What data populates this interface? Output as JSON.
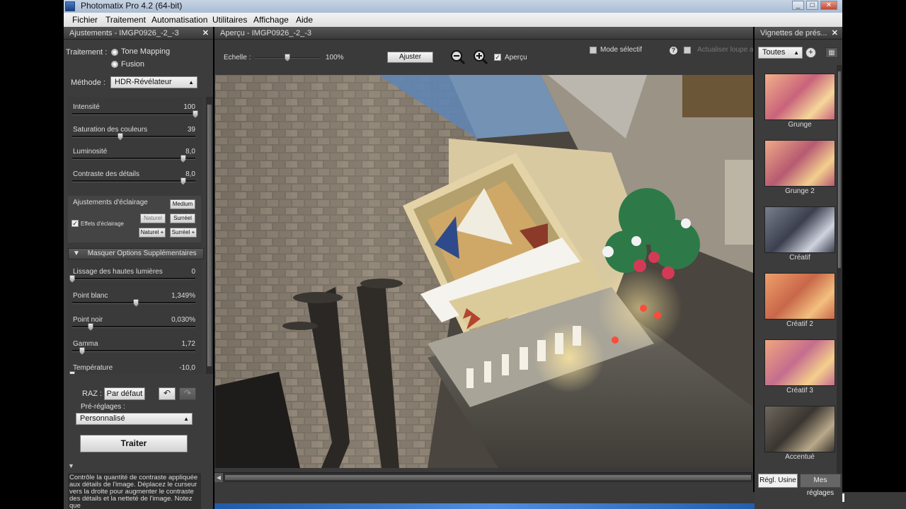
{
  "window": {
    "title": "Photomatix Pro 4.2 (64-bit)",
    "min": "_",
    "max": "□",
    "close": "✕"
  },
  "menu": [
    "Fichier",
    "Traitement",
    "Automatisation",
    "Utilitaires",
    "Affichage",
    "Aide"
  ],
  "left_panel": {
    "title": "Ajustements - IMGP0926_-2_-3",
    "close": "✕",
    "traitement_label": "Traitement :",
    "mode_tone": "Tone Mapping",
    "mode_fusion": "Fusion",
    "methode_label": "Méthode :",
    "methode_value": "HDR-Révélateur",
    "sliders": [
      {
        "name": "Intensité",
        "value": "100",
        "pos": 1.0
      },
      {
        "name": "Saturation des couleurs",
        "value": "39",
        "pos": 0.39
      },
      {
        "name": "Luminosité",
        "value": "8,0",
        "pos": 0.9
      },
      {
        "name": "Contraste des détails",
        "value": "8,0",
        "pos": 0.9
      }
    ],
    "lighting": {
      "label": "Ajustements d'éclairage",
      "medium": "Medium",
      "effects_label": "Effets d'éclairage",
      "checked": "✓",
      "naturel": "Naturel",
      "surreel": "Surréel",
      "naturel_plus": "Naturel +",
      "surreel_plus": "Surréel +"
    },
    "section_label": "Masquer Options Supplémentaires",
    "section_arrow": "▼",
    "extra_sliders": [
      {
        "name": "Lissage des hautes lumières",
        "value": "0",
        "pos": 0.0
      },
      {
        "name": "Point blanc",
        "value": "1,349%",
        "pos": 0.52
      },
      {
        "name": "Point noir",
        "value": "0,030%",
        "pos": 0.15
      },
      {
        "name": "Gamma",
        "value": "1,72",
        "pos": 0.08
      },
      {
        "name": "Température",
        "value": "-10,0",
        "pos": 0.0
      }
    ],
    "raz_label": "RAZ :",
    "default_button": "Par défaut",
    "undo_icon": "↶",
    "redo_icon": "↷",
    "presets_label": "Pré-réglages :",
    "presets_value": "Personnalisé",
    "process_button": "Traiter",
    "help_arrow": "▼",
    "help_text": "Contrôle la quantité de contraste appliquée aux détails de l'image. Déplacez le curseur vers la droite pour augmenter le contraste des détails et la netteté de l'image. Notez que"
  },
  "preview": {
    "title": "Aperçu - IMGP0926_-2_-3",
    "scale_label": "Echelle :",
    "scale_value": "100%",
    "scale_pos": 0.5,
    "fit_button": "Ajuster",
    "zoom_out_icon": "−",
    "zoom_in_icon": "+",
    "preview_checkbox_label": "Aperçu",
    "selective_mode_label": "Mode sélectif",
    "help_icon": "?",
    "update_label": "Actualiser loupe a"
  },
  "right_panel": {
    "title": "Vignettes de prés...",
    "close": "✕",
    "filter_value": "Toutes",
    "thumbnails": [
      "Grunge",
      "Grunge 2",
      "Créatif",
      "Créatif 2",
      "Créatif 3",
      "Accentué"
    ],
    "tab_factory": "Régl. Usine",
    "tab_mine": "Mes réglages"
  },
  "colors": {
    "panel_bg": "#3c3c3c",
    "accent_blue": "#1f5ba8"
  }
}
